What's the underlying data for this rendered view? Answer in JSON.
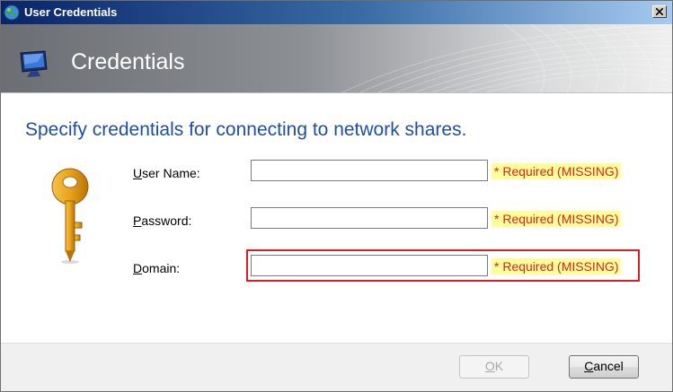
{
  "window": {
    "title": "User Credentials"
  },
  "banner": {
    "title": "Credentials"
  },
  "main": {
    "heading": "Specify credentials for connecting to network shares.",
    "fields": [
      {
        "label_access": "U",
        "label_rest": "ser Name:",
        "value": "",
        "required": "* Required (MISSING)"
      },
      {
        "label_access": "P",
        "label_rest": "assword:",
        "value": "",
        "required": "* Required (MISSING)"
      },
      {
        "label_access": "D",
        "label_rest": "omain:",
        "value": "",
        "required": "* Required (MISSING)"
      }
    ]
  },
  "footer": {
    "ok_access": "O",
    "ok_rest": "K",
    "cancel_access": "C",
    "cancel_rest": "ancel"
  },
  "colors": {
    "heading": "#1e4fa1",
    "required_text": "#e02020",
    "required_bg": "#ffff99",
    "focus_border": "#d81e2a"
  },
  "icons": [
    "globe-icon",
    "close-icon",
    "monitor-icon",
    "key-icon"
  ]
}
